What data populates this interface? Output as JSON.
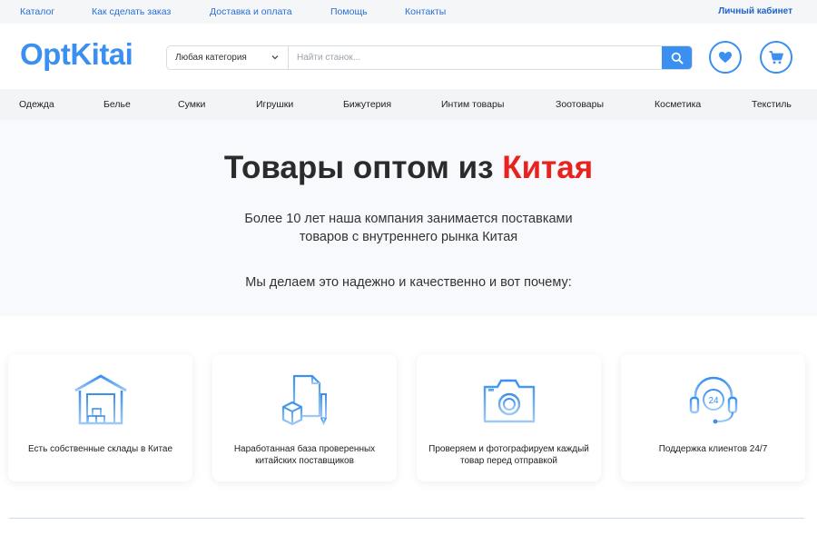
{
  "topbar": {
    "links": [
      "Каталог",
      "Как сделать заказ",
      "Доставка и оплата",
      "Помощь",
      "Контакты"
    ],
    "cabinet": "Личный кабинет"
  },
  "header": {
    "logo": "OptKitai",
    "category_select": "Любая категория",
    "search_placeholder": "Найти станок..."
  },
  "categories": [
    "Одежда",
    "Белье",
    "Сумки",
    "Игрушки",
    "Бижутерия",
    "Интим товары",
    "Зоотовары",
    "Косметика",
    "Текстиль"
  ],
  "hero": {
    "title_main": "Товары оптом из ",
    "title_accent": "Китая",
    "subtitle_line1": "Более 10 лет наша компания занимается поставками",
    "subtitle_line2": "товаров с внутреннего рынка Китая",
    "why": "Мы делаем это надежно и качественно и вот почему:"
  },
  "features": [
    {
      "icon": "warehouse-icon",
      "label": "Есть собственные склады в Китае"
    },
    {
      "icon": "documents-box-icon",
      "label": "Наработанная база проверенных китайских поставщиков"
    },
    {
      "icon": "camera-icon",
      "label": "Проверяем и фотографируем каждый товар перед отправкой"
    },
    {
      "icon": "headset-24-icon",
      "label": "Поддержка клиентов 24/7"
    }
  ],
  "colors": {
    "accent": "#3a8ff0",
    "title_red": "#e8231f",
    "link": "#2a6fd6"
  }
}
